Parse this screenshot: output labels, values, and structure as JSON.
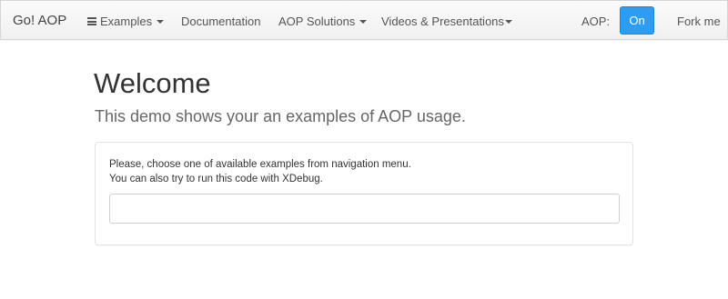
{
  "navbar": {
    "brand": "Go! AOP",
    "items": [
      {
        "label": "Examples"
      },
      {
        "label": "Documentation"
      },
      {
        "label": "AOP Solutions"
      },
      {
        "label": "Videos & Presentations"
      }
    ],
    "aop_label": "AOP:",
    "toggle_label": "On",
    "fork_label": "Fork me"
  },
  "page": {
    "title": "Welcome",
    "lead": "This demo shows your an examples of AOP usage."
  },
  "panel": {
    "line1": "Please, choose one of available examples from navigation menu.",
    "line2": "You can also try to run this code with XDebug.",
    "output_value": ""
  },
  "colors": {
    "accent": "#2d9cf3",
    "navbar_bg": "#f5f5f5",
    "text": "#333333"
  }
}
